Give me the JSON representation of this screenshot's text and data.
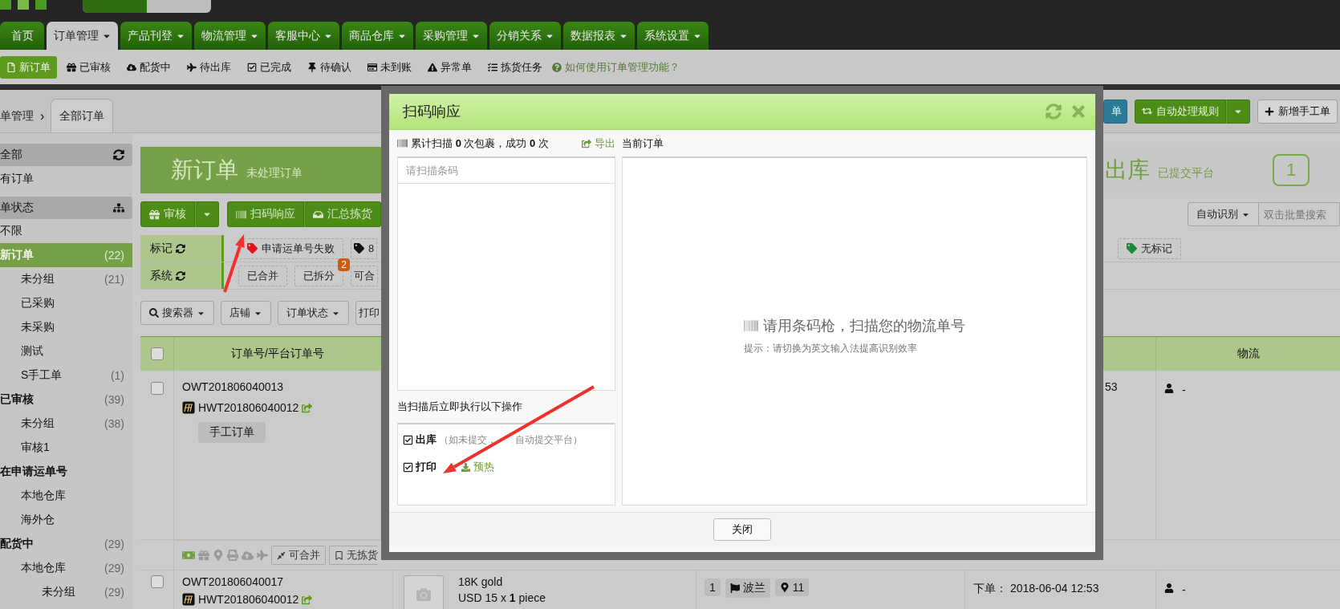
{
  "nav_tabs": [
    {
      "label": "首页",
      "selected": false,
      "dropdown": false
    },
    {
      "label": "订单管理",
      "selected": true,
      "dropdown": true
    },
    {
      "label": "产品刊登",
      "selected": false,
      "dropdown": true
    },
    {
      "label": "物流管理",
      "selected": false,
      "dropdown": true
    },
    {
      "label": "客服中心",
      "selected": false,
      "dropdown": true
    },
    {
      "label": "商品仓库",
      "selected": false,
      "dropdown": true
    },
    {
      "label": "采购管理",
      "selected": false,
      "dropdown": true
    },
    {
      "label": "分销关系",
      "selected": false,
      "dropdown": true
    },
    {
      "label": "数据报表",
      "selected": false,
      "dropdown": true
    },
    {
      "label": "系统设置",
      "selected": false,
      "dropdown": true
    }
  ],
  "sub_nav": {
    "items": [
      {
        "label": "新订单",
        "selected": true
      },
      {
        "label": "已审核",
        "selected": false
      },
      {
        "label": "配货中",
        "selected": false
      },
      {
        "label": "待出库",
        "selected": false
      },
      {
        "label": "已完成",
        "selected": false
      },
      {
        "label": "待确认",
        "selected": false
      },
      {
        "label": "未到账",
        "selected": false
      },
      {
        "label": "异常单",
        "selected": false
      },
      {
        "label": "拣货任务",
        "selected": false
      }
    ],
    "help": "如何使用订单管理功能？"
  },
  "breadcrumb": {
    "parent": "单管理",
    "separator": "›",
    "tab": "全部订单"
  },
  "toolbar": {
    "buttons": [
      {
        "label": "单",
        "kind": "blue"
      },
      {
        "label": "自动处理规则",
        "kind": "green"
      },
      {
        "label": "新增手工单",
        "kind": "plain"
      }
    ]
  },
  "sidebar": [
    {
      "kind": "header",
      "label": "全部"
    },
    {
      "kind": "item",
      "label": "有订单",
      "selected": false
    },
    {
      "kind": "header",
      "label": "单状态"
    },
    {
      "kind": "item",
      "label": "不限",
      "selected": false
    },
    {
      "kind": "item",
      "label": "新订单",
      "count": "(22)",
      "selected": true,
      "children": [
        {
          "kind": "item",
          "label": "未分组",
          "count": "(21)",
          "selected": false
        },
        {
          "kind": "item",
          "label": "已采购",
          "selected": false
        },
        {
          "kind": "item",
          "label": "未采购",
          "selected": false
        },
        {
          "kind": "item",
          "label": "测试",
          "selected": false
        },
        {
          "kind": "item",
          "label": "S手工单",
          "count": "(1)",
          "selected": false
        }
      ]
    },
    {
      "kind": "item",
      "label": "已审核",
      "count": "(39)",
      "selected": false,
      "children": [
        {
          "kind": "item",
          "label": "未分组",
          "count": "(38)",
          "selected": false
        },
        {
          "kind": "item",
          "label": "审核1",
          "selected": false
        }
      ]
    },
    {
      "kind": "item",
      "label": "在申请运单号",
      "selected": false,
      "children": [
        {
          "kind": "item",
          "label": "本地仓库",
          "selected": false
        },
        {
          "kind": "item",
          "label": "海外仓",
          "selected": false
        }
      ]
    },
    {
      "kind": "item",
      "label": "配货中",
      "count": "(29)",
      "selected": false,
      "children": [
        {
          "kind": "item",
          "label": "本地仓库",
          "count": "(29)",
          "selected": false,
          "children": [
            {
              "kind": "item",
              "label": "未分组",
              "count": "(29)",
              "selected": false
            }
          ]
        }
      ]
    }
  ],
  "banner": {
    "title": "新订单",
    "subtitle": "未处理订单",
    "right_title": "出库",
    "right_subtitle": "已提交平台",
    "count": "1"
  },
  "actions": {
    "audit": "审核",
    "scan": "扫码响应",
    "summary": "汇总拣货",
    "recognize": "自动识别",
    "search_placeholder": "双击批量搜索"
  },
  "filters": [
    {
      "label": "标记",
      "tags": [
        {
          "text": "申请运单号失败",
          "color": "#e0141e"
        },
        {
          "text": "8",
          "color": "#111111"
        }
      ],
      "right_tags": [
        {
          "text": "无标记",
          "color": "#1a8a3a"
        }
      ]
    },
    {
      "label": "系统",
      "tags": [
        {
          "text": "已合并"
        },
        {
          "text": "已拆分",
          "badge": "2"
        },
        {
          "text": "可合"
        }
      ]
    }
  ],
  "dropdowns": [
    "搜索器",
    "店铺",
    "订单状态",
    "打印"
  ],
  "table": {
    "columns": [
      "订单号/平台订单号",
      "物流"
    ],
    "header_checked": false,
    "rows": [
      {
        "checked": false,
        "order_no": "OWT201806040013",
        "platform_no": "HWT201806040012",
        "tag": "手工订单",
        "time": "53",
        "logistics": "-",
        "actions": [
          "可合并",
          "无拣货"
        ]
      },
      {
        "checked": false,
        "order_no": "OWT201806040017",
        "platform_no": "HWT201806040012",
        "product": "18K gold",
        "price": "USD 15 x **1** piece",
        "qty": "1",
        "country": "波兰",
        "pin": "11",
        "placed": "下单： 2018-06-04 12:53",
        "logistics": "-"
      }
    ]
  },
  "dialog": {
    "title": "扫码响应",
    "stats": "累计扫描 **0** 次包裹，成功 **0** 次",
    "export": "导出",
    "current_order": "当前订单",
    "scan_placeholder": "请扫描条码",
    "after_scan_label": "当扫描后立即执行以下操作",
    "options": [
      {
        "label": "出库",
        "note": [
          "（如未提交，",
          "自动提交平台）"
        ],
        "checked": true
      },
      {
        "label": "打印",
        "link": "预热",
        "checked": true
      }
    ],
    "empty_title": "请用条码枪，扫描您的物流单号",
    "empty_hint": "提示：请切换为英文输入法提高识别效率",
    "close": "关闭"
  }
}
